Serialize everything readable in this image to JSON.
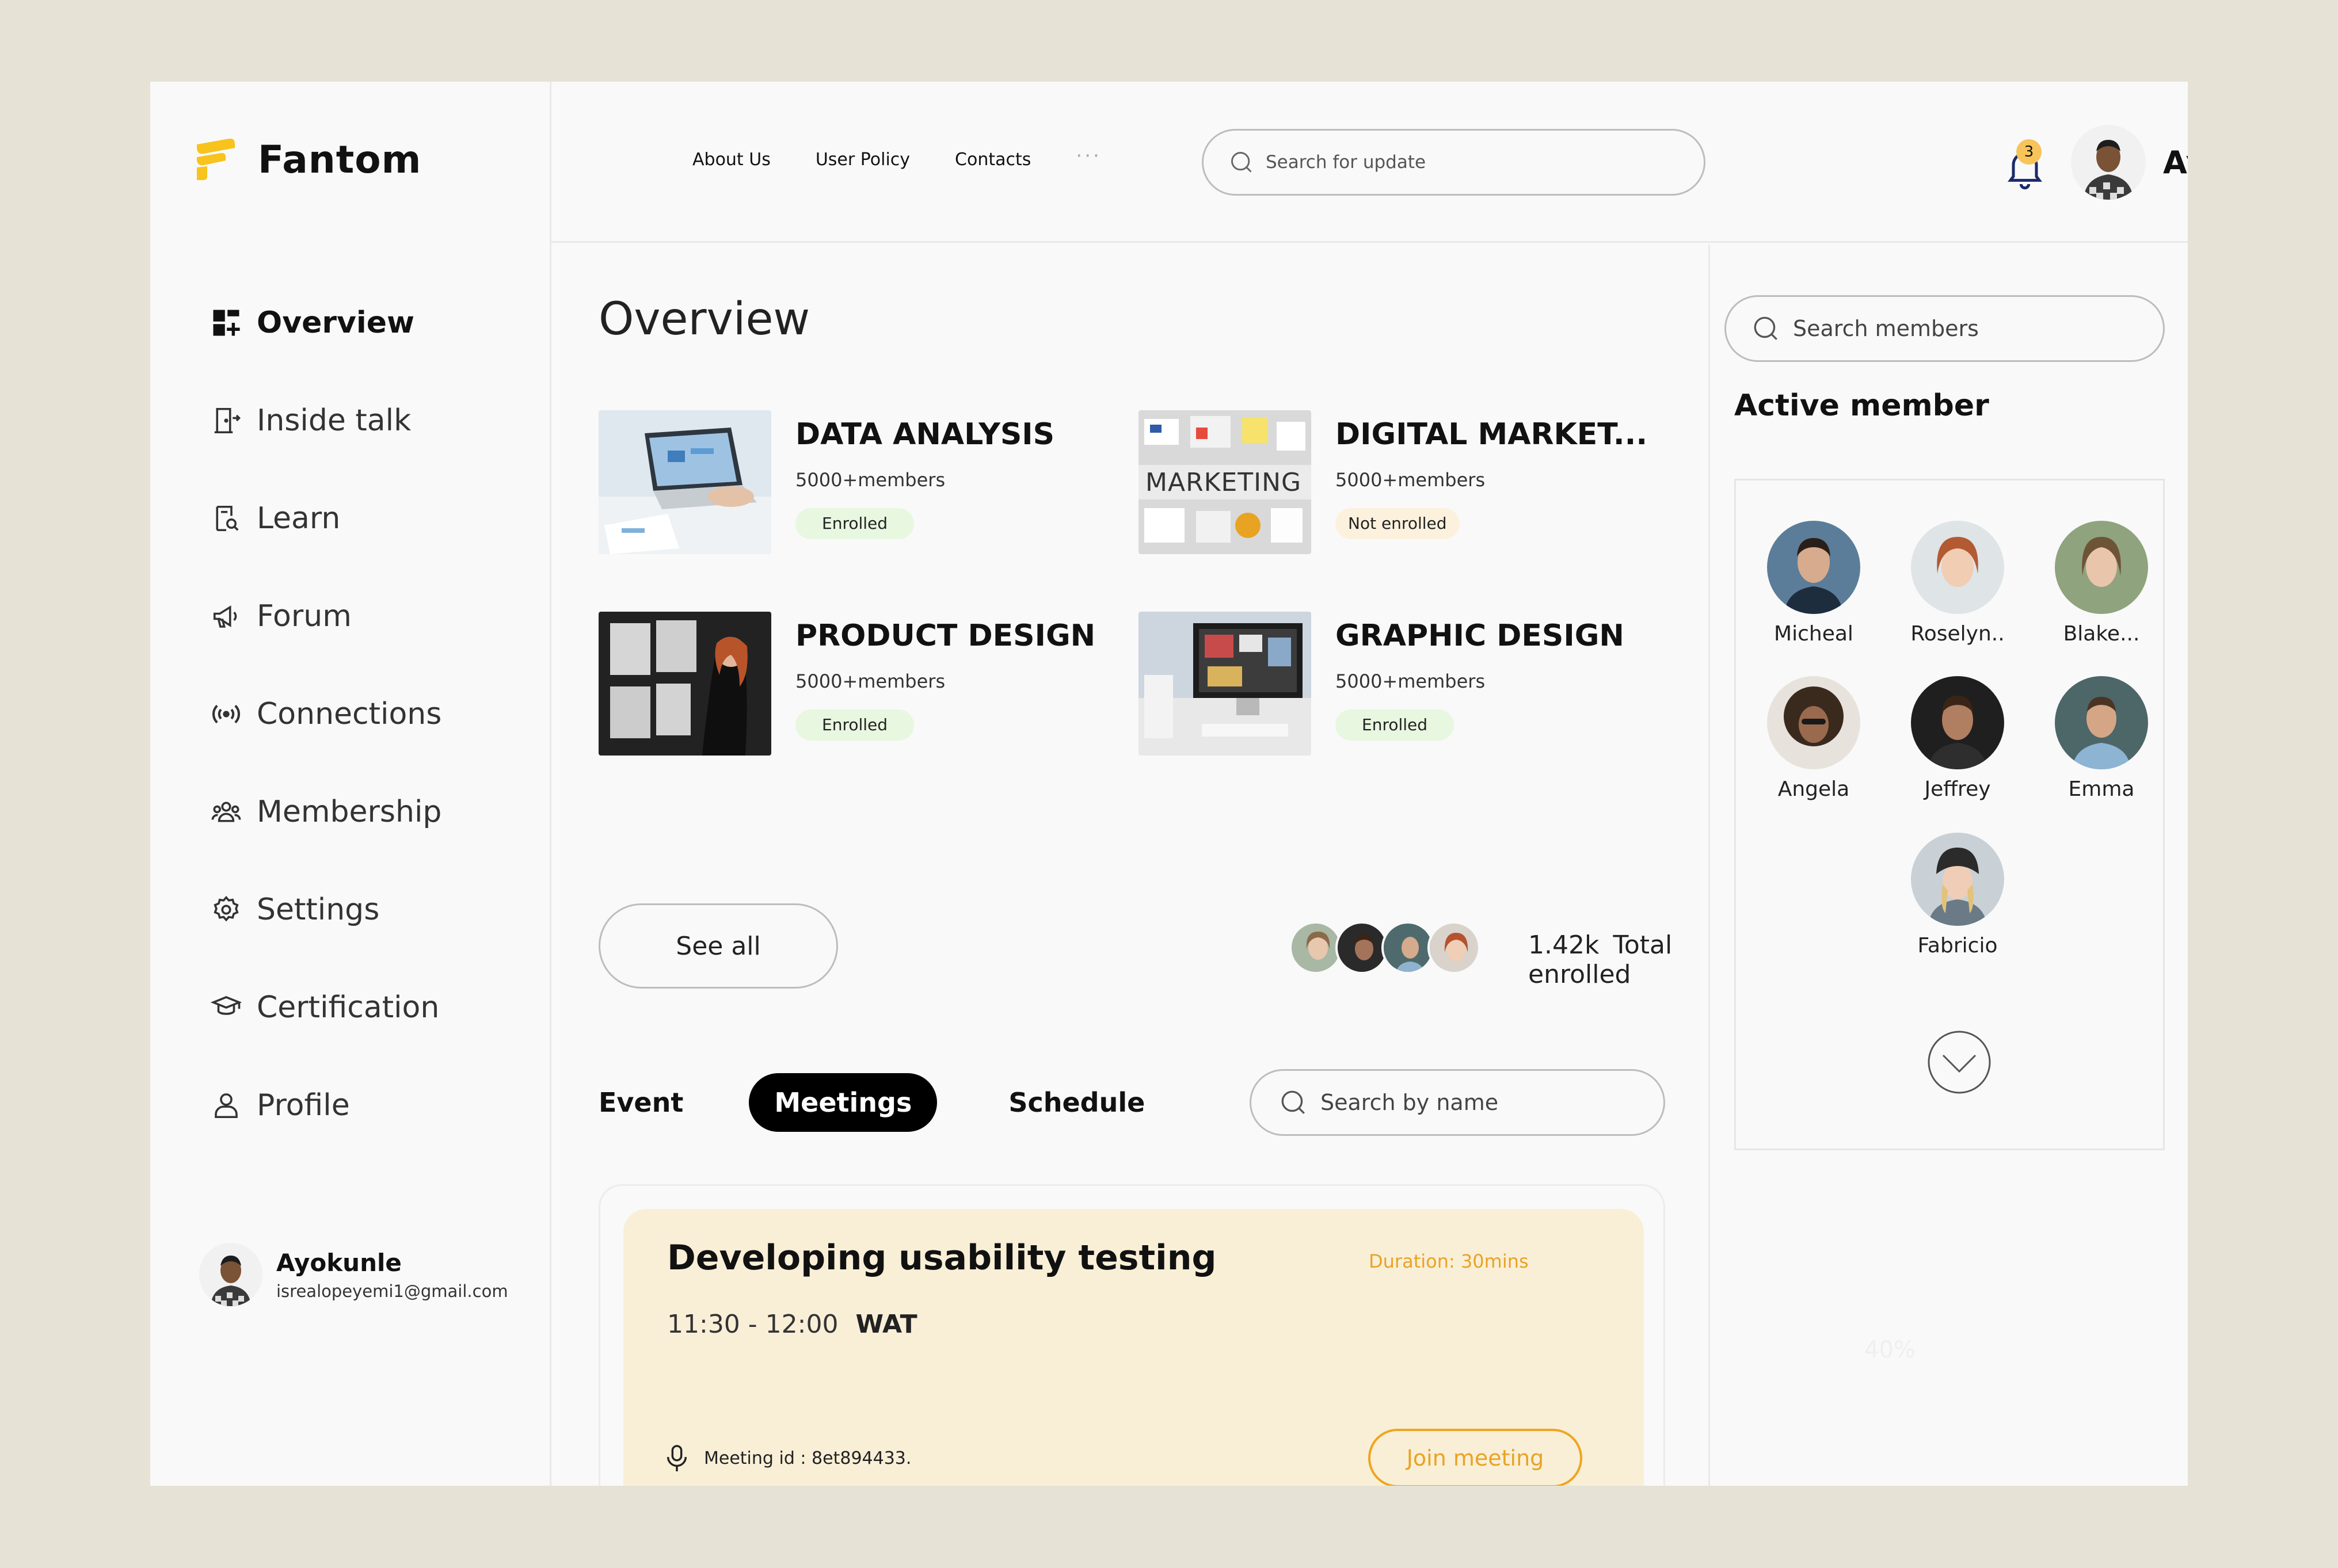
{
  "brand": {
    "name": "Fantom",
    "color": "#f7c31c"
  },
  "sidebar": {
    "items": [
      {
        "label": "Overview",
        "icon": "grid-plus-icon",
        "active": true
      },
      {
        "label": "Inside talk",
        "icon": "door-exit-icon"
      },
      {
        "label": "Learn",
        "icon": "book-search-icon"
      },
      {
        "label": "Forum",
        "icon": "megaphone-icon"
      },
      {
        "label": "Connections",
        "icon": "broadcast-icon"
      },
      {
        "label": "Membership",
        "icon": "users-group-icon"
      },
      {
        "label": "Settings",
        "icon": "gear-icon"
      },
      {
        "label": "Certification",
        "icon": "graduation-cap-icon"
      },
      {
        "label": "Profile",
        "icon": "user-icon"
      }
    ],
    "user": {
      "name": "Ayokunle",
      "email": "isrealopeyemi1@gmail.com"
    }
  },
  "header": {
    "nav": [
      "About Us",
      "User Policy",
      "Contacts"
    ],
    "more": "···",
    "search_placeholder": "Search for update",
    "notifications": "3",
    "user_name": "Ayokunle"
  },
  "main": {
    "title": "Overview",
    "courses": [
      {
        "title": "DATA ANALYSIS",
        "members": "5000+members",
        "status": "Enrolled"
      },
      {
        "title": "DIGITAL MARKET...",
        "members": "5000+members",
        "status": "Not enrolled",
        "thumb_text": "MARKETING"
      },
      {
        "title": "PRODUCT DESIGN",
        "members": "5000+members",
        "status": "Enrolled"
      },
      {
        "title": "GRAPHIC DESIGN",
        "members": "5000+members",
        "status": "Enrolled"
      }
    ],
    "see_all": "See all",
    "total_count": "1.42k",
    "total_label": "Total enrolled",
    "tabs": [
      "Event",
      "Meetings",
      "Schedule"
    ],
    "active_tab": "Meetings",
    "search_placeholder": "Search by name",
    "meeting": {
      "title": "Developing usability testing",
      "duration": "Duration: 30mins",
      "time": "11:30 - 12:00",
      "timezone": "WAT",
      "meeting_id": "Meeting id : 8et894433.",
      "join": "Join meeting"
    }
  },
  "right": {
    "search_placeholder": "Search members",
    "title": "Active member",
    "members": [
      "Micheal",
      "Roselyn..",
      "Blake...",
      "Angela",
      "Jeffrey",
      "Emma",
      "Fabricio"
    ],
    "faint_text": "40%"
  },
  "colors": {
    "accent_orange": "#e9a323",
    "enrolled_bg": "#e8f7e0",
    "not_enrolled_bg": "#fcf1dc",
    "meeting_bg": "#f9efd7",
    "page_bg": "#e6e3d6"
  }
}
